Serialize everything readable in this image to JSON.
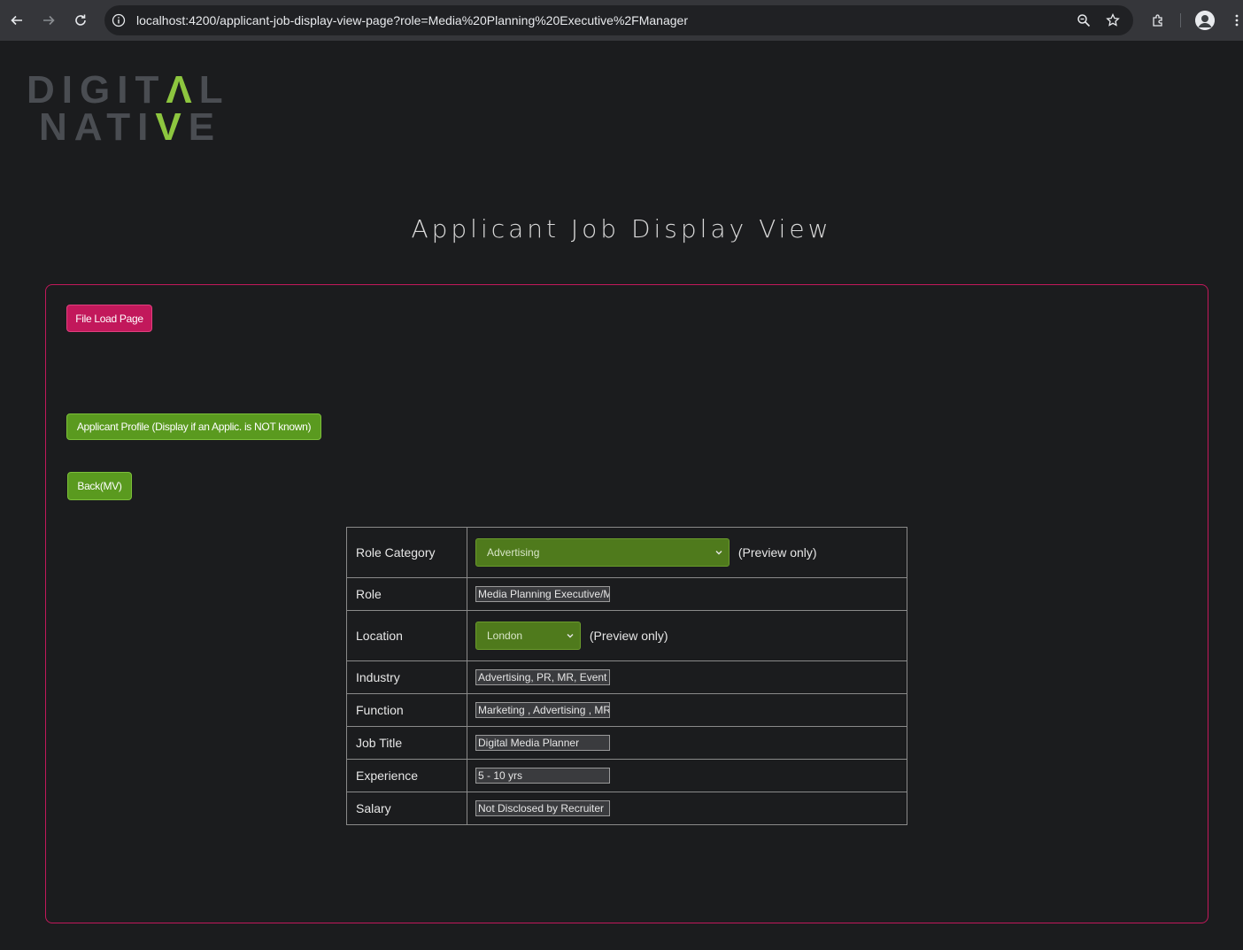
{
  "browser": {
    "url": "localhost:4200/applicant-job-display-view-page?role=Media%20Planning%20Executive%2FManager"
  },
  "logo": {
    "line1_pre": "DIGIT",
    "line1_accent": "Λ",
    "line1_post": "L",
    "line2_pre": "NATI",
    "line2_accent": "V",
    "line2_post": "E"
  },
  "page": {
    "title": "Applicant Job Display View"
  },
  "buttons": {
    "file_load": "File Load Page",
    "applicant_profile": "Applicant Profile (Display if an Applic. is NOT known)",
    "back": "Back(MV)"
  },
  "job": {
    "preview_note": "(Preview only)",
    "rows": {
      "role_category": {
        "label": "Role Category",
        "value": "Advertising"
      },
      "role": {
        "label": "Role",
        "value": "Media Planning Executive/Manager"
      },
      "location": {
        "label": "Location",
        "value": "London"
      },
      "industry": {
        "label": "Industry",
        "value": "Advertising, PR, MR, Event Management"
      },
      "function": {
        "label": "Function",
        "value": "Marketing , Advertising , MR , PR"
      },
      "job_title": {
        "label": "Job Title",
        "value": "Digital Media Planner"
      },
      "experience": {
        "label": "Experience",
        "value": "5 - 10 yrs"
      },
      "salary": {
        "label": "Salary",
        "value": "Not Disclosed by Recruiter"
      }
    }
  },
  "colors": {
    "accent_pink": "#c2185b",
    "accent_green": "#5a9a1f",
    "logo_green": "#8dc63f",
    "background": "#1b1c1e"
  }
}
